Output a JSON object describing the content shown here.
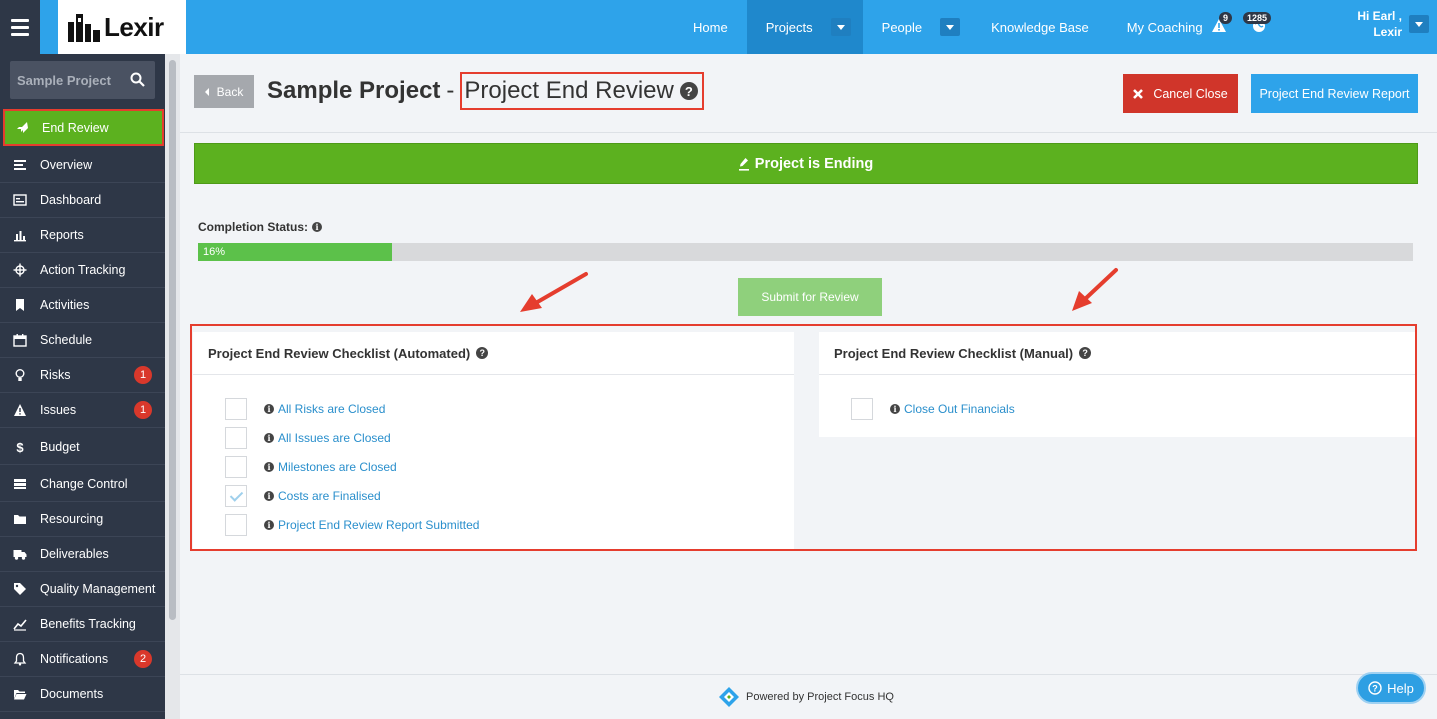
{
  "app": {
    "brand": "Lexir"
  },
  "topnav": {
    "items": [
      {
        "label": "Home"
      },
      {
        "label": "Projects"
      },
      {
        "label": "People"
      },
      {
        "label": "Knowledge Base"
      },
      {
        "label": "My Coaching"
      }
    ],
    "alert_count": "9",
    "info_count": "1285",
    "user_greeting": "Hi Earl ,",
    "user_org": "Lexir"
  },
  "sidebar": {
    "search_value": "Sample Project",
    "items": [
      {
        "label": "End Review",
        "icon": "rocket-icon"
      },
      {
        "label": "Overview",
        "icon": "list-icon"
      },
      {
        "label": "Dashboard",
        "icon": "dashboard-icon"
      },
      {
        "label": "Reports",
        "icon": "bar-chart-icon"
      },
      {
        "label": "Action Tracking",
        "icon": "crosshair-icon"
      },
      {
        "label": "Activities",
        "icon": "bookmark-icon"
      },
      {
        "label": "Schedule",
        "icon": "calendar-icon"
      },
      {
        "label": "Risks",
        "icon": "lightbulb-icon",
        "badge": "1"
      },
      {
        "label": "Issues",
        "icon": "warning-icon",
        "badge": "1"
      },
      {
        "label": "Budget",
        "icon": "dollar-icon"
      },
      {
        "label": "Change Control",
        "icon": "server-icon"
      },
      {
        "label": "Resourcing",
        "icon": "folder-icon"
      },
      {
        "label": "Deliverables",
        "icon": "truck-icon"
      },
      {
        "label": "Quality Management",
        "icon": "tag-icon"
      },
      {
        "label": "Benefits Tracking",
        "icon": "line-chart-icon"
      },
      {
        "label": "Notifications",
        "icon": "bell-icon",
        "badge": "2"
      },
      {
        "label": "Documents",
        "icon": "folder-open-icon"
      }
    ]
  },
  "header": {
    "back_label": "Back",
    "project_name": "Sample Project",
    "separator": "-",
    "page_title": "Project End Review",
    "cancel_label": "Cancel Close",
    "report_label": "Project End Review Report"
  },
  "banner": {
    "text": "Project is Ending"
  },
  "completion": {
    "label": "Completion Status:",
    "percent": 16,
    "percent_text": "16%"
  },
  "submit_label": "Submit for Review",
  "automated": {
    "title": "Project End Review Checklist (Automated)",
    "items": [
      {
        "label": "All Risks are Closed",
        "checked": false
      },
      {
        "label": "All Issues are Closed",
        "checked": false
      },
      {
        "label": "Milestones are Closed",
        "checked": false
      },
      {
        "label": "Costs are Finalised",
        "checked": true
      },
      {
        "label": "Project End Review Report Submitted",
        "checked": false
      }
    ]
  },
  "manual": {
    "title": "Project End Review Checklist (Manual)",
    "items": [
      {
        "label": "Close Out Financials",
        "checked": false
      }
    ]
  },
  "footer": {
    "text": "Powered by Project Focus HQ"
  },
  "help_label": "Help",
  "colors": {
    "brand_blue": "#2ea3ea",
    "sidebar": "#2e3747",
    "success": "#5cb11f",
    "danger": "#d0352a",
    "annotation": "#e53d2e"
  }
}
